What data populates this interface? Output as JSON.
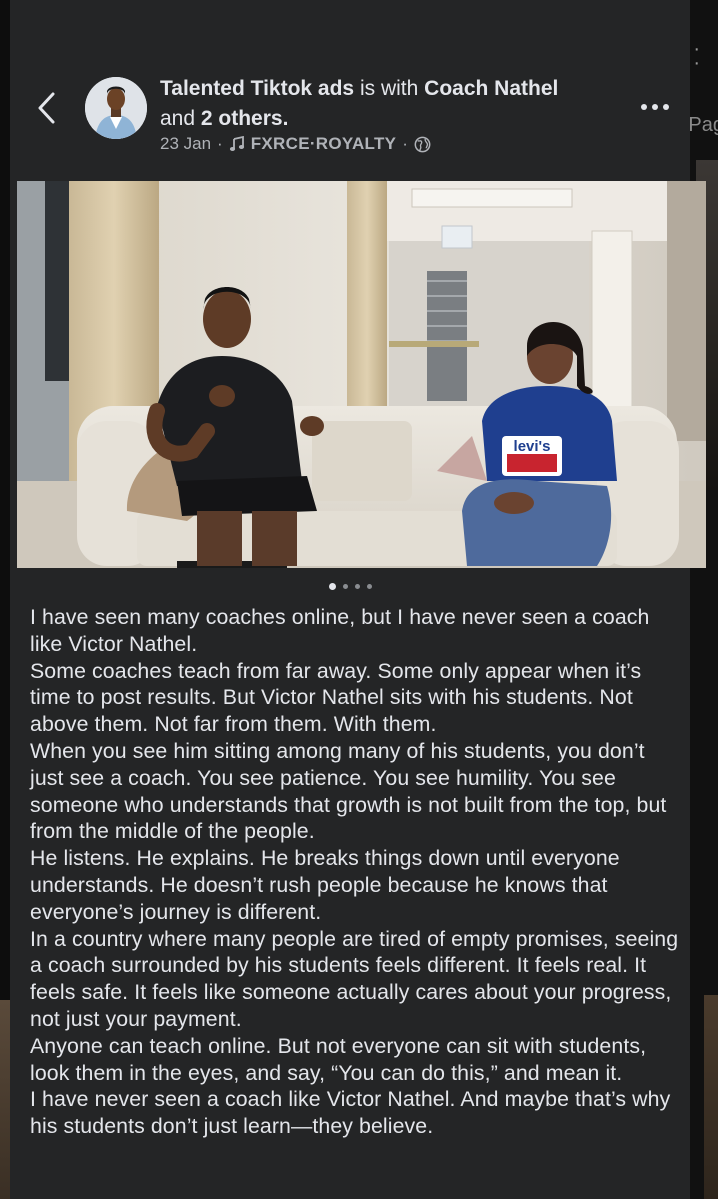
{
  "background": {
    "side_label": "Pag"
  },
  "post": {
    "author": "Talented Tiktok ads",
    "with_text": "is with",
    "tagged": "Coach Nathel",
    "and_text": "and",
    "others": "2 others.",
    "date": "23 Jan",
    "separator": "·",
    "music": "FXRCE·ROYALTY",
    "privacy_icon": "globe-icon",
    "carousel": {
      "count": 4,
      "active": 0
    },
    "paragraphs": [
      "I have seen many coaches online, but I have never seen a coach like Victor Nathel.",
      "Some coaches teach from far away. Some only appear when it’s time to post results. But Victor Nathel sits with his students. Not above them. Not far from them. With them.",
      "When you see him sitting among many of his students, you don’t just see a coach. You see patience. You see humility. You see someone who understands that growth is not built from the top, but from the middle of the people.",
      "He listens. He explains. He breaks things down until everyone understands. He doesn’t rush people because he knows that everyone’s journey is different.",
      "In a country where many people are tired of empty promises, seeing a coach surrounded by his students feels different. It feels real. It feels safe. It feels like someone actually cares about your progress, not just your payment.",
      "Anyone can teach online. But not everyone can sit with students, look them in the eyes, and say, “You can do this,” and mean it.",
      "I have never seen a coach like Victor Nathel. And maybe that’s why his students don’t just learn—they believe."
    ]
  },
  "photo": {
    "shirt_text": "levi's"
  },
  "colors": {
    "card_bg": "#242526",
    "text_primary": "#e4e6eb",
    "text_secondary": "#b0b3b8"
  }
}
